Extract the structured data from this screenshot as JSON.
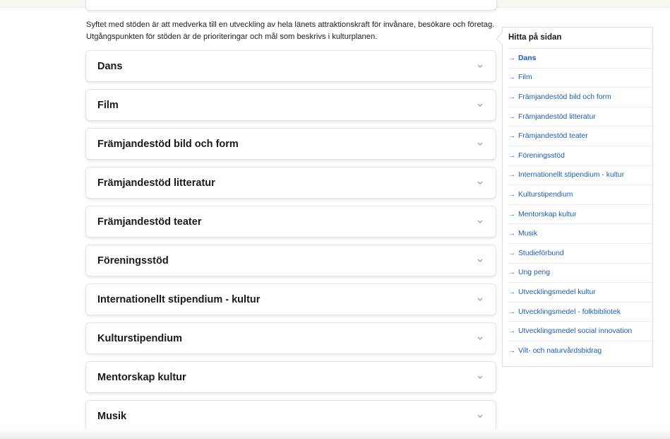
{
  "intro_text": "Syftet med stöden är att medverka till en utveckling av hela länets attraktionskraft för invånare, besökare och företag. Utgångspunkten för stöden är de prioriteringar och mål som beskrivs i kulturplanen.",
  "accordion": {
    "items": [
      {
        "label": "Dans"
      },
      {
        "label": "Film"
      },
      {
        "label": "Främjandestöd bild och form"
      },
      {
        "label": "Främjandestöd litteratur"
      },
      {
        "label": "Främjandestöd teater"
      },
      {
        "label": "Föreningsstöd"
      },
      {
        "label": "Internationellt stipendium - kultur"
      },
      {
        "label": "Kulturstipendium"
      },
      {
        "label": "Mentorskap kultur"
      },
      {
        "label": "Musik"
      }
    ],
    "chevron_icon": "chevron-down-icon"
  },
  "toc": {
    "title": "Hitta på sidan",
    "arrow": "→",
    "link_color": "#1a5fb4",
    "items": [
      {
        "label": "Dans"
      },
      {
        "label": "Film"
      },
      {
        "label": "Främjandestöd bild och form"
      },
      {
        "label": "Främjandestöd litteratur"
      },
      {
        "label": "Främjandestöd teater"
      },
      {
        "label": "Föreningsstöd"
      },
      {
        "label": "Internationellt stipendium - kultur"
      },
      {
        "label": "Kulturstipendium"
      },
      {
        "label": "Mentorskap kultur"
      },
      {
        "label": "Musik"
      },
      {
        "label": "Studieförbund"
      },
      {
        "label": "Ung peng"
      },
      {
        "label": "Utvecklingsmedel kultur"
      },
      {
        "label": "Utvecklingsmedel - folkbibliotek"
      },
      {
        "label": "Utvecklingsmedel social innovation"
      },
      {
        "label": "Vilt- och naturvårdsbidrag"
      }
    ]
  }
}
